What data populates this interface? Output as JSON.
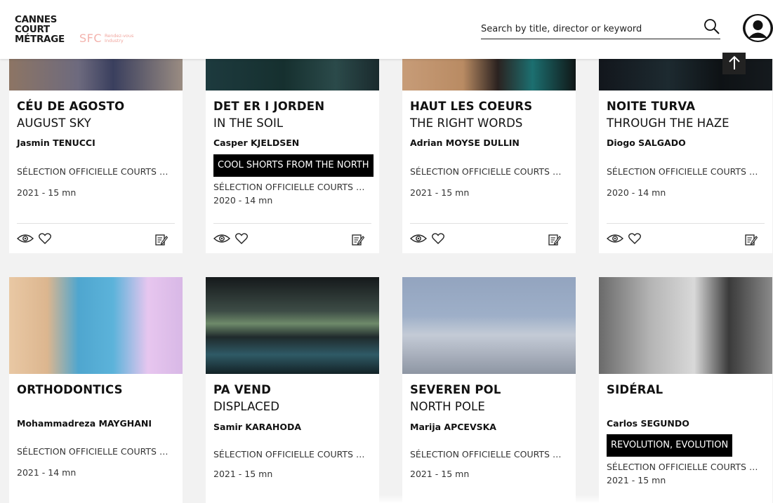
{
  "header": {
    "logo_lines": [
      "CANNES",
      "COURT",
      "MÉTRAGE"
    ],
    "sfc_mark": "SFC",
    "sfc_sub_lines": [
      "Rendez-vous",
      "Industry"
    ],
    "search_placeholder": "Search by title, director or keyword"
  },
  "icons": {
    "search": "search-icon",
    "avatar": "user-avatar-icon",
    "scroll_top": "arrow-up-icon",
    "view": "eye-icon",
    "like": "heart-icon",
    "note": "note-edit-icon"
  },
  "cards": [
    {
      "title": "CÉU DE AGOSTO",
      "subtitle": "AUGUST SKY",
      "director": "Jasmin TENUCCI",
      "badge": "",
      "selection": "SÉLECTION OFFICIELLE COURTS MÉTRAGES",
      "meta": "2021 - 15 mn"
    },
    {
      "title": "DET ER I JORDEN",
      "subtitle": "IN THE SOIL",
      "director": "Casper KJELDSEN",
      "badge": "COOL SHORTS FROM THE NORTH",
      "selection": "SÉLECTION OFFICIELLE COURTS MÉTRAGES",
      "meta": "2020 - 14 mn"
    },
    {
      "title": "HAUT LES COEURS",
      "subtitle": "THE RIGHT WORDS",
      "director": "Adrian MOYSE DULLIN",
      "badge": "",
      "selection": "SÉLECTION OFFICIELLE COURTS MÉTRAGES",
      "meta": "2021 - 15 mn"
    },
    {
      "title": "NOITE TURVA",
      "subtitle": "THROUGH THE HAZE",
      "director": "Diogo SALGADO",
      "badge": "",
      "selection": "SÉLECTION OFFICIELLE COURTS MÉTRAGES",
      "meta": "2020 - 14 mn"
    },
    {
      "title": "ORTHODONTICS",
      "subtitle": "",
      "director": "Mohammadreza MAYGHANI",
      "badge": "",
      "selection": "SÉLECTION OFFICIELLE COURTS MÉTRAGES",
      "meta": "2021 - 14 mn"
    },
    {
      "title": "PA VEND",
      "subtitle": "DISPLACED",
      "director": "Samir KARAHODA",
      "badge": "",
      "selection": "SÉLECTION OFFICIELLE COURTS MÉTRAGES",
      "meta": "2021 - 15 mn"
    },
    {
      "title": "SEVEREN POL",
      "subtitle": "NORTH POLE",
      "director": "Marija APCEVSKA",
      "badge": "",
      "selection": "SÉLECTION OFFICIELLE COURTS MÉTRAGES",
      "meta": "2021 - 15 mn"
    },
    {
      "title": "SIDÉRAL",
      "subtitle": "",
      "director": "Carlos SEGUNDO",
      "badge": "REVOLUTION, EVOLUTION",
      "selection": "SÉLECTION OFFICIELLE COURTS MÉTRAGES",
      "meta": "2021 - 15 mn"
    }
  ]
}
